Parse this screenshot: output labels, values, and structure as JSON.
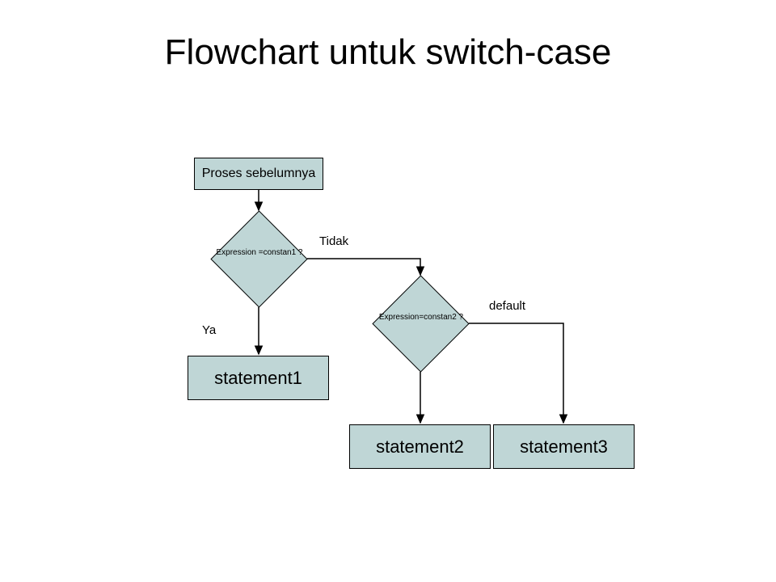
{
  "title": "Flowchart untuk switch-case",
  "nodes": {
    "start": "Proses sebelumnya",
    "decision1": "Expression =constan1 ?",
    "decision2": "Expression=constan2 ?",
    "stmt1": "statement1",
    "stmt2": "statement2",
    "stmt3": "statement3"
  },
  "edges": {
    "yes": "Ya",
    "no": "Tidak",
    "default": "default"
  },
  "chart_data": {
    "type": "flowchart",
    "title": "Flowchart untuk switch-case",
    "nodes": [
      {
        "id": "start",
        "type": "process",
        "label": "Proses sebelumnya"
      },
      {
        "id": "d1",
        "type": "decision",
        "label": "Expression =constan1 ?"
      },
      {
        "id": "d2",
        "type": "decision",
        "label": "Expression=constan2 ?"
      },
      {
        "id": "s1",
        "type": "process",
        "label": "statement1"
      },
      {
        "id": "s2",
        "type": "process",
        "label": "statement2"
      },
      {
        "id": "s3",
        "type": "process",
        "label": "statement3"
      }
    ],
    "edges": [
      {
        "from": "start",
        "to": "d1",
        "label": ""
      },
      {
        "from": "d1",
        "to": "s1",
        "label": "Ya"
      },
      {
        "from": "d1",
        "to": "d2",
        "label": "Tidak"
      },
      {
        "from": "d2",
        "to": "s2",
        "label": ""
      },
      {
        "from": "d2",
        "to": "s3",
        "label": "default"
      }
    ]
  }
}
